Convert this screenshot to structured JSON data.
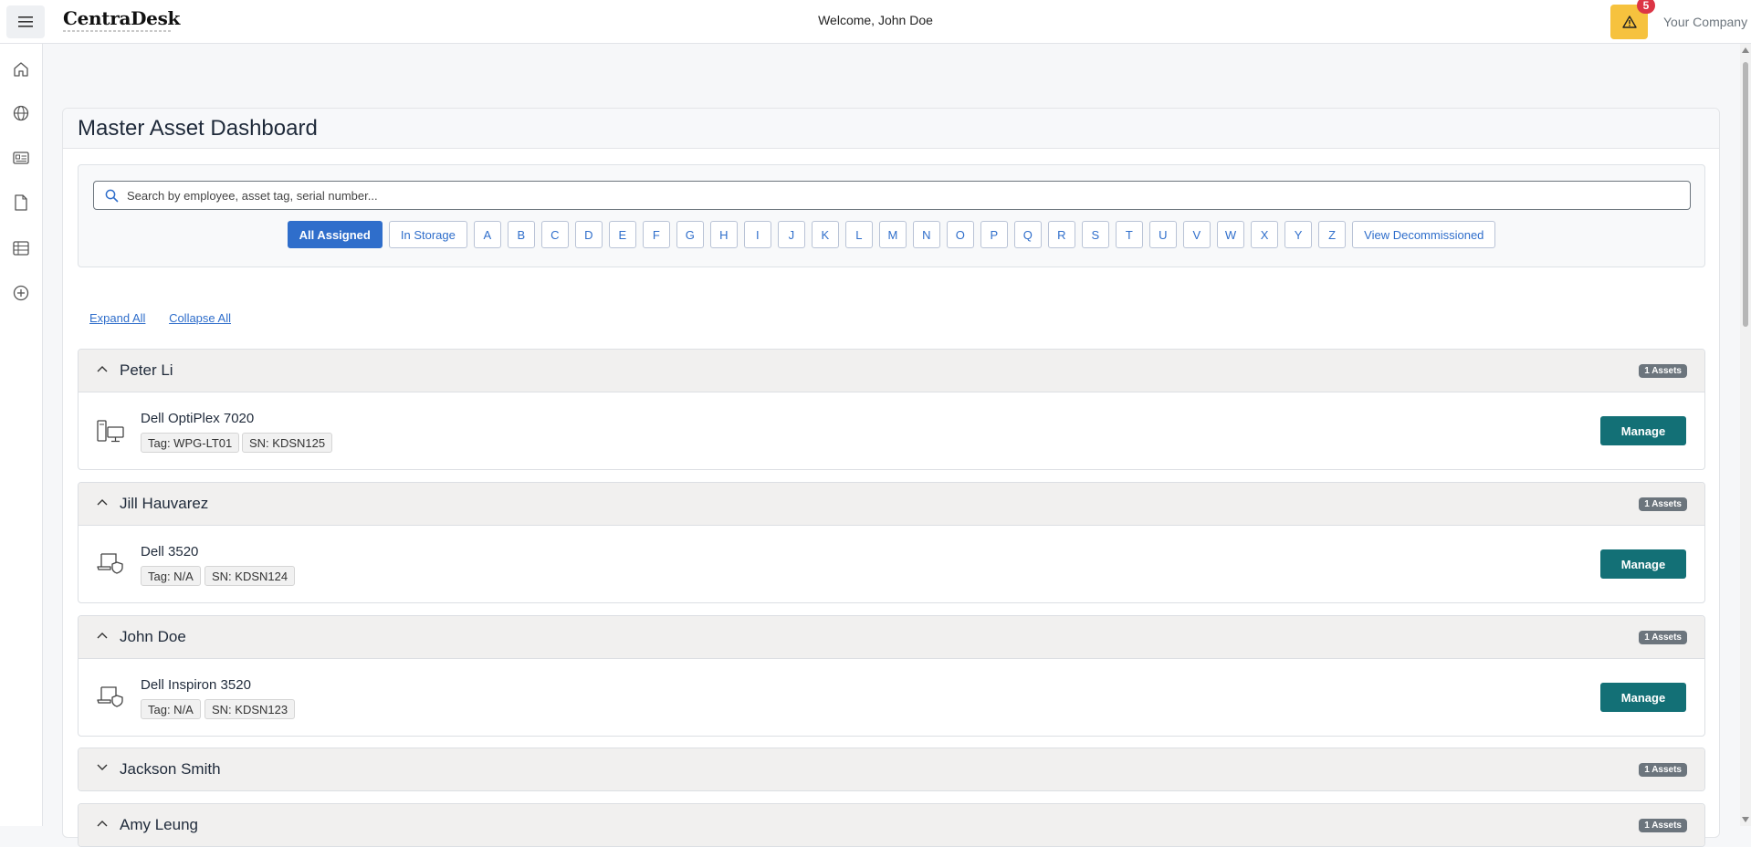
{
  "header": {
    "brand": "CentraDesk",
    "welcome": "Welcome, John Doe",
    "alert_count": "5",
    "company": "Your Company"
  },
  "sidebar": {
    "items": [
      {
        "icon": "home-icon"
      },
      {
        "icon": "globe-icon"
      },
      {
        "icon": "id-card-icon"
      },
      {
        "icon": "document-icon"
      },
      {
        "icon": "table-icon"
      },
      {
        "icon": "plus-circle-icon"
      }
    ]
  },
  "page": {
    "title": "Master Asset Dashboard"
  },
  "search": {
    "placeholder": "Search by employee, asset tag, serial number..."
  },
  "filters": {
    "all_assigned": "All Assigned",
    "in_storage": "In Storage",
    "letters": [
      "A",
      "B",
      "C",
      "D",
      "E",
      "F",
      "G",
      "H",
      "I",
      "J",
      "K",
      "L",
      "M",
      "N",
      "O",
      "P",
      "Q",
      "R",
      "S",
      "T",
      "U",
      "V",
      "W",
      "X",
      "Y",
      "Z"
    ],
    "decommissioned": "View Decommissioned"
  },
  "links": {
    "expand_all": "Expand All",
    "collapse_all": "Collapse All"
  },
  "manage_label": "Manage",
  "groups": [
    {
      "name": "Peter Li",
      "count": "1 Assets",
      "expanded": true,
      "asset": {
        "name": "Dell OptiPlex 7020",
        "tag": "Tag: WPG-LT01",
        "sn": "SN: KDSN125",
        "icon": "desktop-icon"
      }
    },
    {
      "name": "Jill Hauvarez",
      "count": "1 Assets",
      "expanded": true,
      "asset": {
        "name": "Dell 3520",
        "tag": "Tag: N/A",
        "sn": "SN: KDSN124",
        "icon": "laptop-shield-icon"
      }
    },
    {
      "name": "John Doe",
      "count": "1 Assets",
      "expanded": true,
      "asset": {
        "name": "Dell Inspiron 3520",
        "tag": "Tag: N/A",
        "sn": "SN: KDSN123",
        "icon": "laptop-shield-icon"
      }
    },
    {
      "name": "Jackson Smith",
      "count": "1 Assets",
      "expanded": false
    },
    {
      "name": "Amy Leung",
      "count": "1 Assets",
      "expanded": true
    }
  ],
  "colors": {
    "primary": "#2f6ecb",
    "manage": "#137076",
    "alert": "#f6c23e",
    "badge": "#dc3545"
  }
}
